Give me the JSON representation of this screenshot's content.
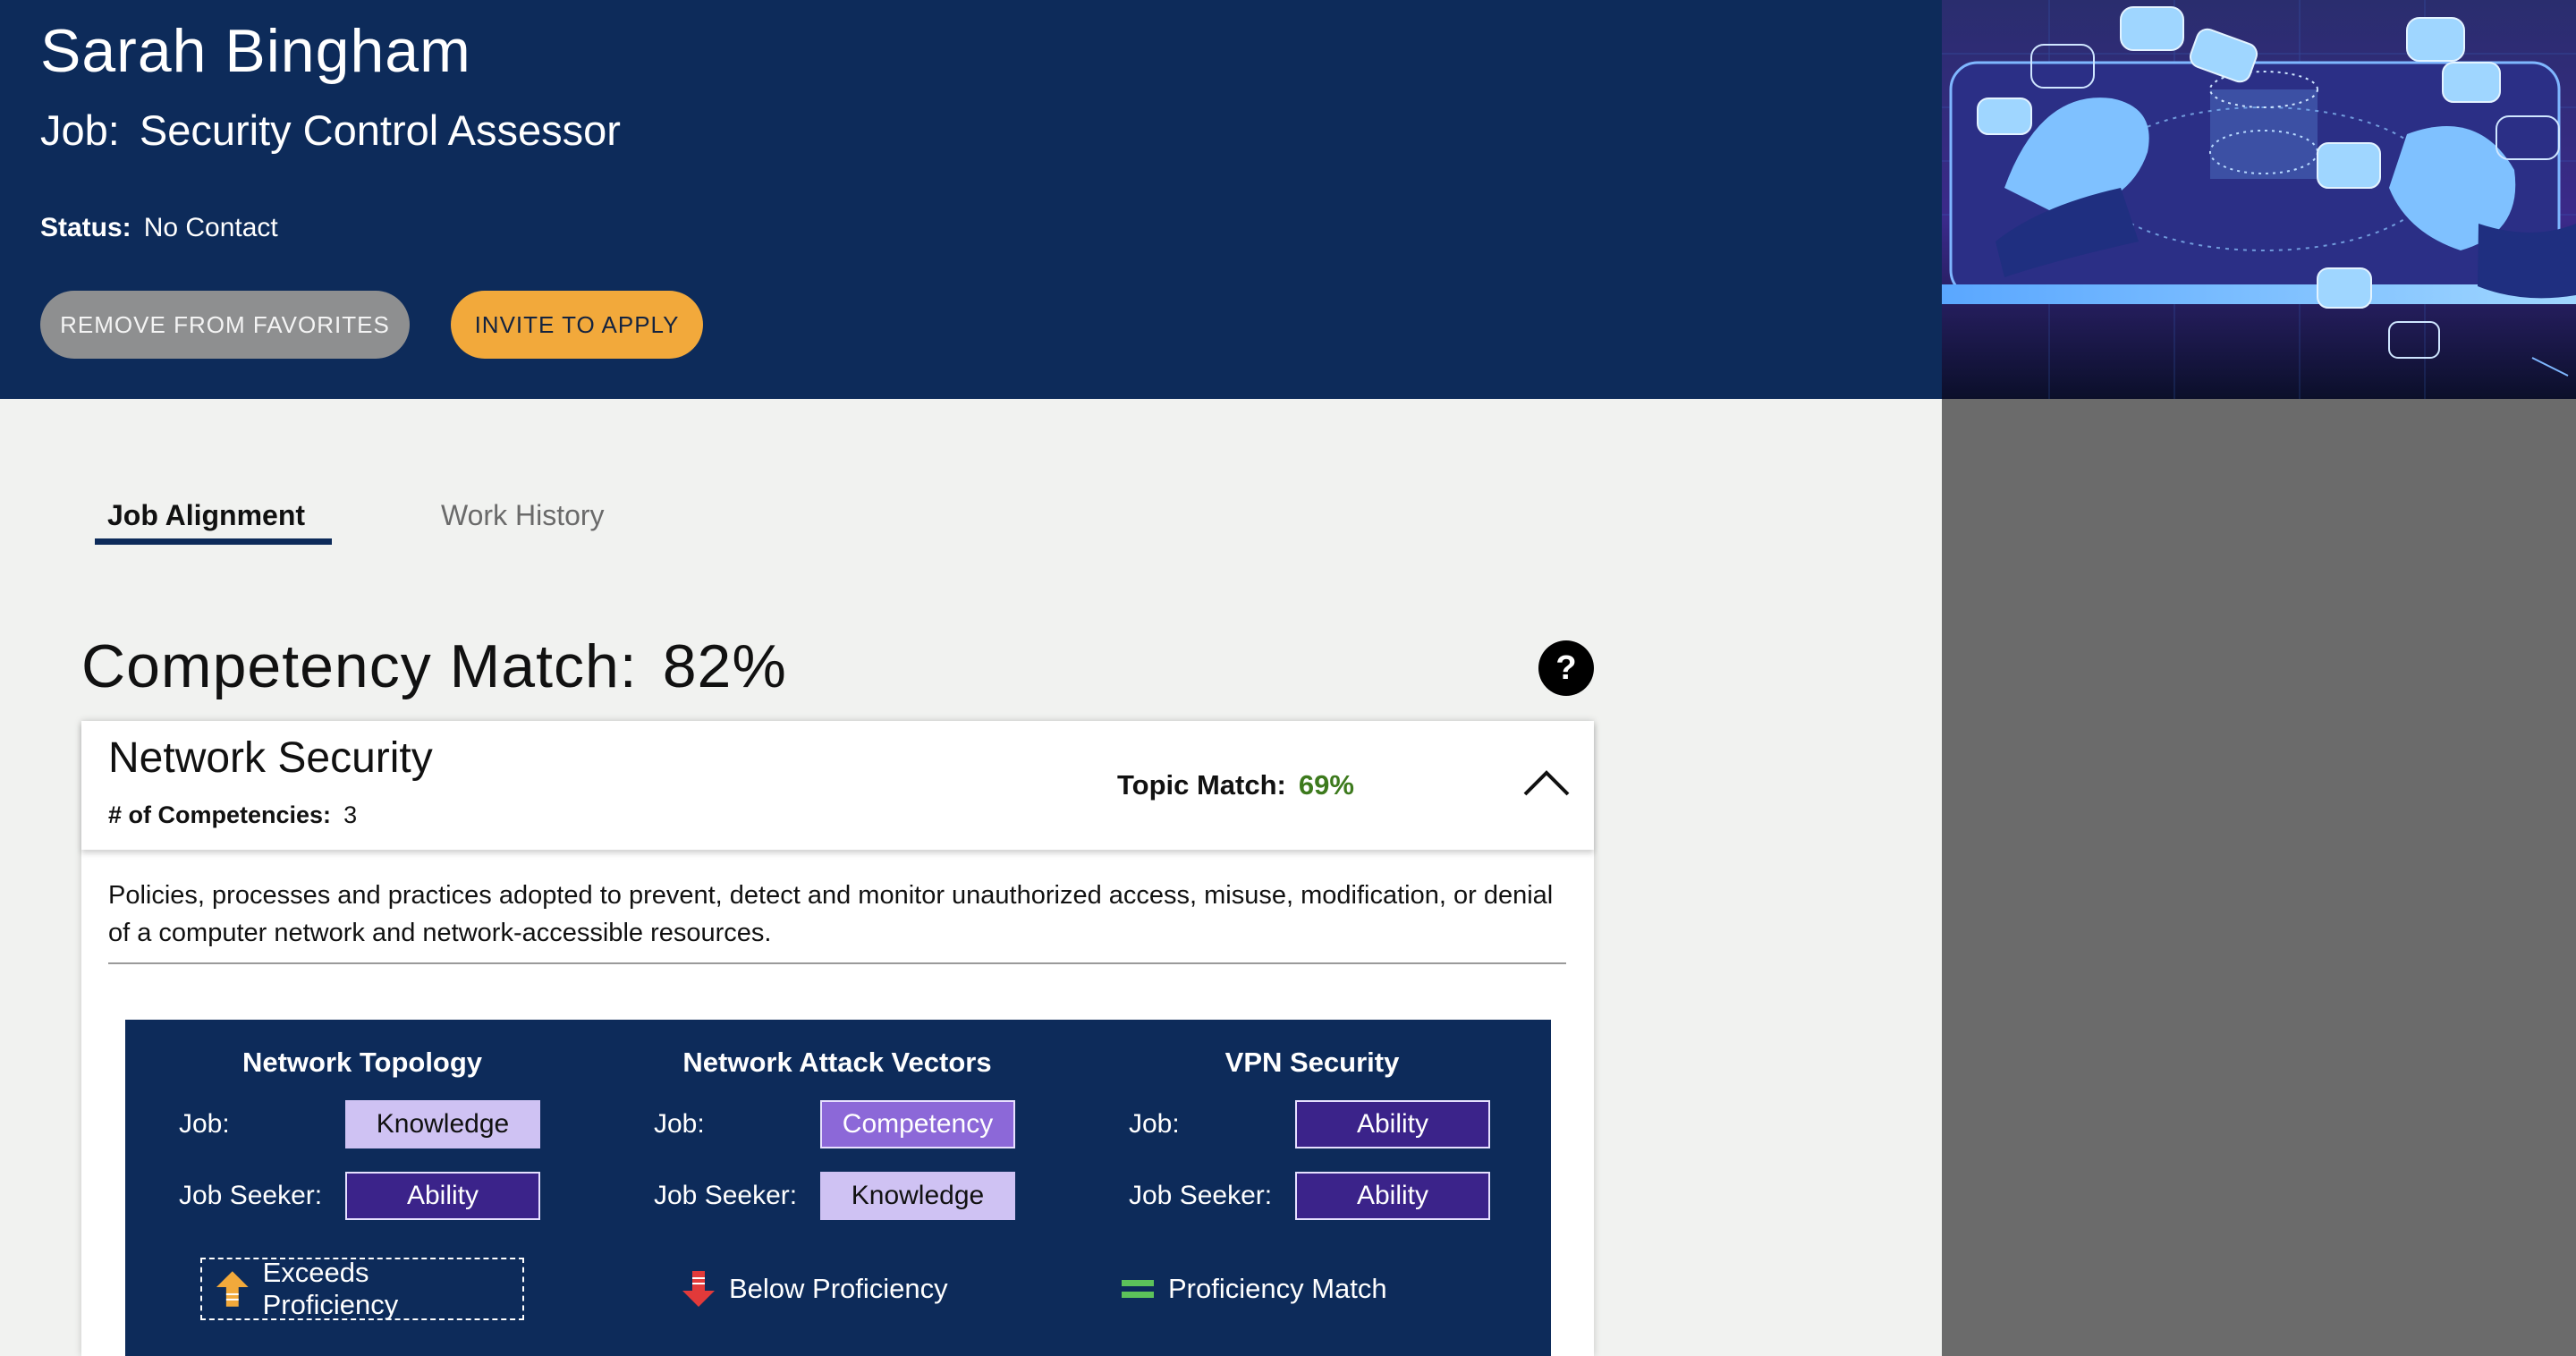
{
  "header": {
    "candidate_name": "Sarah Bingham",
    "job_label": "Job:",
    "job_title": "Security Control Assessor",
    "status_label": "Status:",
    "status_value": "No Contact",
    "remove_favorites_label": "REMOVE FROM FAVORITES",
    "invite_label": "INVITE TO APPLY"
  },
  "hero_image": {
    "description_icon": "hands-holograph-illustration"
  },
  "tabs": [
    {
      "label": "Job Alignment",
      "active": true
    },
    {
      "label": "Work History",
      "active": false
    }
  ],
  "competency": {
    "title": "Competency Match:",
    "value": "82%",
    "help_icon": "question-icon",
    "help_glyph": "?"
  },
  "topic": {
    "name": "Network Security",
    "count_label": "# of Competencies:",
    "count": "3",
    "match_label": "Topic Match:",
    "match_value": "69%",
    "description": "Policies, processes and practices adopted to prevent, detect and monitor unauthorized access, misuse, modification, or denial of a computer network and network-accessible resources.",
    "columns": [
      {
        "title": "Network Topology",
        "job_label": "Job:",
        "job_value": "Knowledge",
        "seeker_label": "Job Seeker:",
        "seeker_value": "Ability",
        "legend": "Exceeds Proficiency",
        "legend_icon": "arrow-up-icon"
      },
      {
        "title": "Network Attack Vectors",
        "job_label": "Job:",
        "job_value": "Competency",
        "seeker_label": "Job Seeker:",
        "seeker_value": "Knowledge",
        "legend": "Below Proficiency",
        "legend_icon": "arrow-down-icon"
      },
      {
        "title": "VPN Security",
        "job_label": "Job:",
        "job_value": "Ability",
        "seeker_label": "Job Seeker:",
        "seeker_value": "Ability",
        "legend": "Proficiency Match",
        "legend_icon": "equals-icon"
      }
    ]
  },
  "colors": {
    "navy": "#0d2b5a",
    "accent_orange": "#f2a93b",
    "match_green": "#3d7a1d",
    "knowledge": "#cfc2f3",
    "competency": "#8c68d8",
    "ability": "#3b238a"
  }
}
